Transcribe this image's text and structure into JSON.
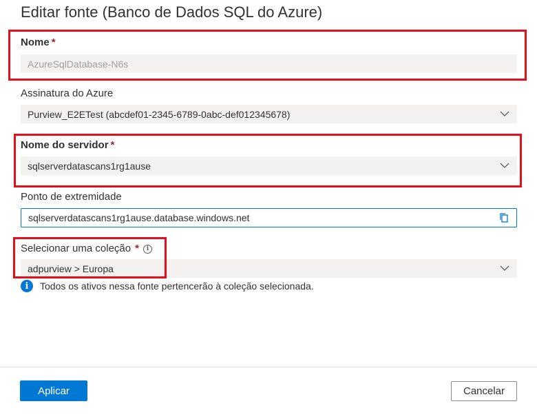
{
  "header": {
    "title": "Editar fonte (Banco de Dados SQL do Azure)"
  },
  "form": {
    "nome": {
      "label": "Nome",
      "required": "*",
      "value": "AzureSqlDatabase-N6s"
    },
    "assinatura": {
      "label": "Assinatura do Azure",
      "value": "Purview_E2ETest (abcdef01-2345-6789-0abc-def012345678)"
    },
    "servidor": {
      "label": "Nome do servidor",
      "required": "*",
      "value": "sqlserverdatascans1rg1ause"
    },
    "ponto": {
      "label": "Ponto de extremidade",
      "value": "sqlserverdatascans1rg1ause.database.windows.net"
    },
    "colecao": {
      "label": "Selecionar uma coleção",
      "required": "*",
      "value": "adpurview > Europa"
    },
    "info": {
      "text": "Todos os ativos nessa fonte pertencerão à coleção selecionada."
    }
  },
  "footer": {
    "apply_label": "Aplicar",
    "cancel_label": "Cancelar"
  },
  "colors": {
    "accent": "#0078d4",
    "highlight": "#e3101b",
    "required": "#a4262c"
  }
}
